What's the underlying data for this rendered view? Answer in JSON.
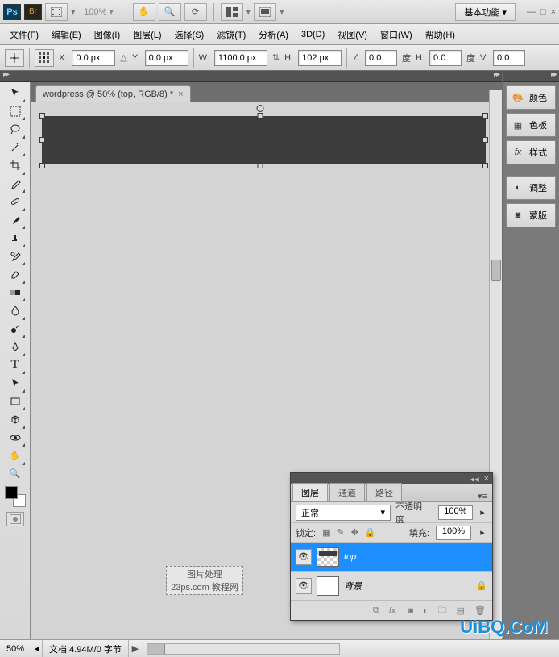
{
  "appbar": {
    "ps": "Ps",
    "br": "Br",
    "zoom": "100% ▾",
    "workspace_label": "基本功能 ▾",
    "min": "—",
    "max": "□",
    "close": "×"
  },
  "menus": {
    "file": "文件(F)",
    "edit": "编辑(E)",
    "image": "图像(I)",
    "layer": "图层(L)",
    "select": "选择(S)",
    "filter": "滤镜(T)",
    "analyze": "分析(A)",
    "threeD": "3D(D)",
    "view": "视图(V)",
    "window": "窗口(W)",
    "help": "帮助(H)"
  },
  "options": {
    "x_label": "X:",
    "x_val": "0.0 px",
    "y_label": "Y:",
    "y_val": "0.0 px",
    "w_label": "W:",
    "w_val": "1100.0 px",
    "h_label": "H:",
    "h_val": "102 px",
    "angle_label": "",
    "angle_val": "0.0",
    "deg": "度",
    "hs_label": "H:",
    "hs_val": "0.0",
    "v_label": "V:",
    "v_val": "0.0"
  },
  "doc": {
    "tab_title": "wordpress @ 50% (top, RGB/8) *",
    "watermark_l1": "图片处理",
    "watermark_l2": "23ps.com 教程网"
  },
  "right_panels": {
    "color": "颜色",
    "swatches": "色板",
    "styles": "样式",
    "adjust": "调整",
    "masks": "蒙版"
  },
  "layers_panel": {
    "tab_layers": "图层",
    "tab_channels": "通道",
    "tab_paths": "路径",
    "blend": "正常",
    "opacity_label": "不透明度:",
    "opacity_val": "100%",
    "lock_label": "锁定:",
    "fill_label": "填充:",
    "fill_val": "100%",
    "layers": [
      {
        "name": "top",
        "selected": true,
        "hasLock": false
      },
      {
        "name": "背景",
        "selected": false,
        "hasLock": true
      }
    ]
  },
  "status": {
    "zoom": "50%",
    "docinfo": "文档:4.94M/0 字节",
    "arrow": "▶"
  },
  "brand": "UiBQ.CoM"
}
